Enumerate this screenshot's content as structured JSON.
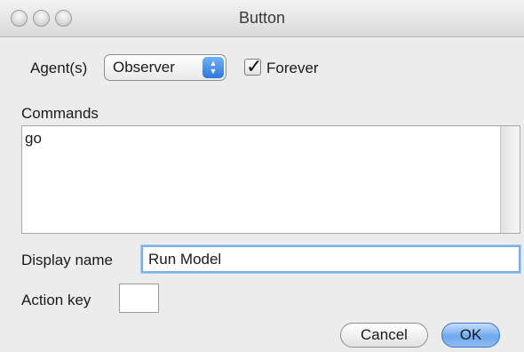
{
  "window": {
    "title": "Button"
  },
  "form": {
    "agents_label": "Agent(s)",
    "agents_value": "Observer",
    "forever_label": "Forever",
    "forever_checked": true,
    "commands_label": "Commands",
    "commands_value": "go",
    "display_name_label": "Display name",
    "display_name_value": "Run Model",
    "action_key_label": "Action key",
    "action_key_value": ""
  },
  "buttons": {
    "cancel": "Cancel",
    "ok": "OK"
  }
}
